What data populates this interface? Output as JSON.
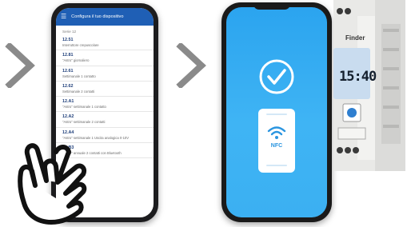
{
  "app": {
    "title": "Configura il tuo dispositivo",
    "section": "Serie 12",
    "items": [
      {
        "code": "12.51",
        "desc": "Interruttore crepuscolare"
      },
      {
        "code": "12.81",
        "desc": "\"Astro\" giornaliero"
      },
      {
        "code": "12.61",
        "desc": "Settimanale 1 contatto"
      },
      {
        "code": "12.62",
        "desc": "Settimanale 2 contatti"
      },
      {
        "code": "12.A1",
        "desc": "\"Astro\" settimanale 1 contatto"
      },
      {
        "code": "12.A2",
        "desc": "\"Astro\" settimanale 2 contatti"
      },
      {
        "code": "12.A4",
        "desc": "\"Astro\" settimanale 1 Uscita analogica 0-10V"
      },
      {
        "code": "12.B3",
        "desc": "\"Astro\" annuale 2 contatti con Bluetooth"
      }
    ]
  },
  "nfc": {
    "label": "NFC"
  },
  "device": {
    "brand": "Finder",
    "time": "15:40"
  },
  "colors": {
    "app_bar": "#1f5fb5",
    "phone_screen": "#34acf2",
    "chevron": "#8a8a8a",
    "lcd": "#cfe2f4"
  }
}
